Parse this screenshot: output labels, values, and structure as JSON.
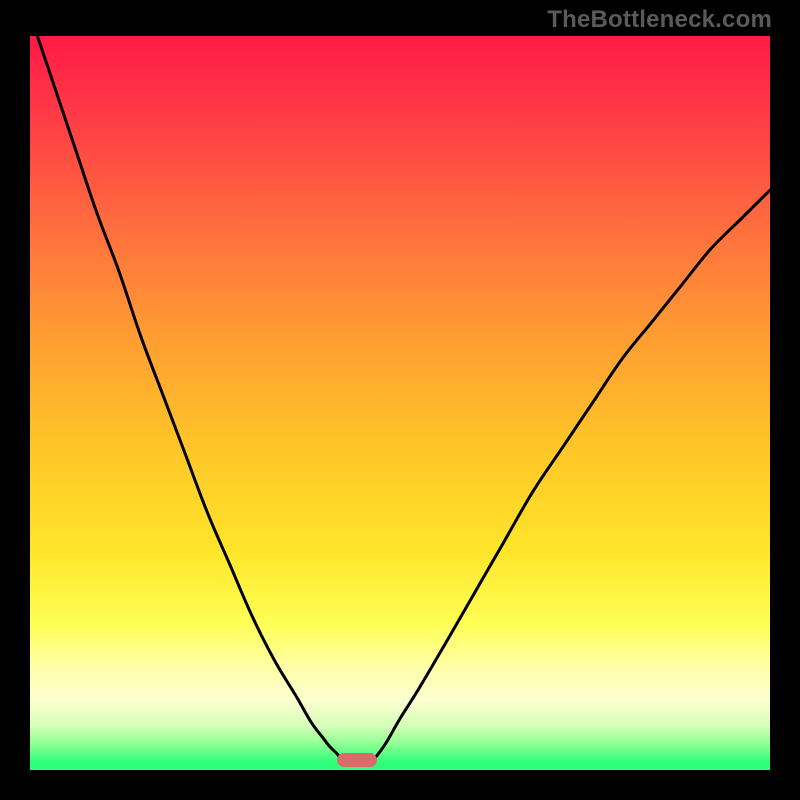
{
  "watermark": "TheBottleneck.com",
  "colors": {
    "gradient_stops": [
      {
        "offset": 0.0,
        "color": "#ff1a45"
      },
      {
        "offset": 0.1,
        "color": "#ff3846"
      },
      {
        "offset": 0.25,
        "color": "#ff6a3f"
      },
      {
        "offset": 0.4,
        "color": "#ff9a33"
      },
      {
        "offset": 0.55,
        "color": "#ffc328"
      },
      {
        "offset": 0.7,
        "color": "#ffe52a"
      },
      {
        "offset": 0.8,
        "color": "#ffff55"
      },
      {
        "offset": 0.86,
        "color": "#ffffa8"
      },
      {
        "offset": 0.905,
        "color": "#fcffd0"
      },
      {
        "offset": 0.94,
        "color": "#d6ffb8"
      },
      {
        "offset": 0.965,
        "color": "#8dff94"
      },
      {
        "offset": 0.99,
        "color": "#2eff7a"
      }
    ],
    "frame": "#000000",
    "curve": "#000000",
    "marker": "#d96b6b"
  },
  "chart_data": {
    "type": "line",
    "title": "",
    "xlabel": "",
    "ylabel": "",
    "xlim": [
      0,
      100
    ],
    "ylim": [
      0,
      100
    ],
    "series": [
      {
        "name": "left-branch",
        "x": [
          0,
          3,
          6,
          9,
          12,
          15,
          18,
          21,
          24,
          27,
          30,
          33,
          36,
          38,
          39.5,
          40.5,
          41.5,
          42,
          42.5
        ],
        "y": [
          103,
          94,
          85,
          76,
          68,
          59,
          51,
          43,
          35,
          28,
          21,
          15,
          10,
          6.5,
          4.5,
          3.2,
          2.2,
          1.5,
          1.0
        ]
      },
      {
        "name": "right-branch",
        "x": [
          46,
          46.5,
          47.3,
          48.3,
          50,
          52.5,
          56,
          60,
          64,
          68,
          72,
          76,
          80,
          84,
          88,
          92,
          96,
          100
        ],
        "y": [
          1.0,
          1.5,
          2.5,
          4,
          7,
          11,
          17,
          24,
          31,
          38,
          44,
          50,
          56,
          61,
          66,
          71,
          75,
          79
        ]
      }
    ],
    "marker": {
      "x_center": 44.2,
      "y": 1.3,
      "width": 5.4,
      "height": 1.9
    }
  }
}
